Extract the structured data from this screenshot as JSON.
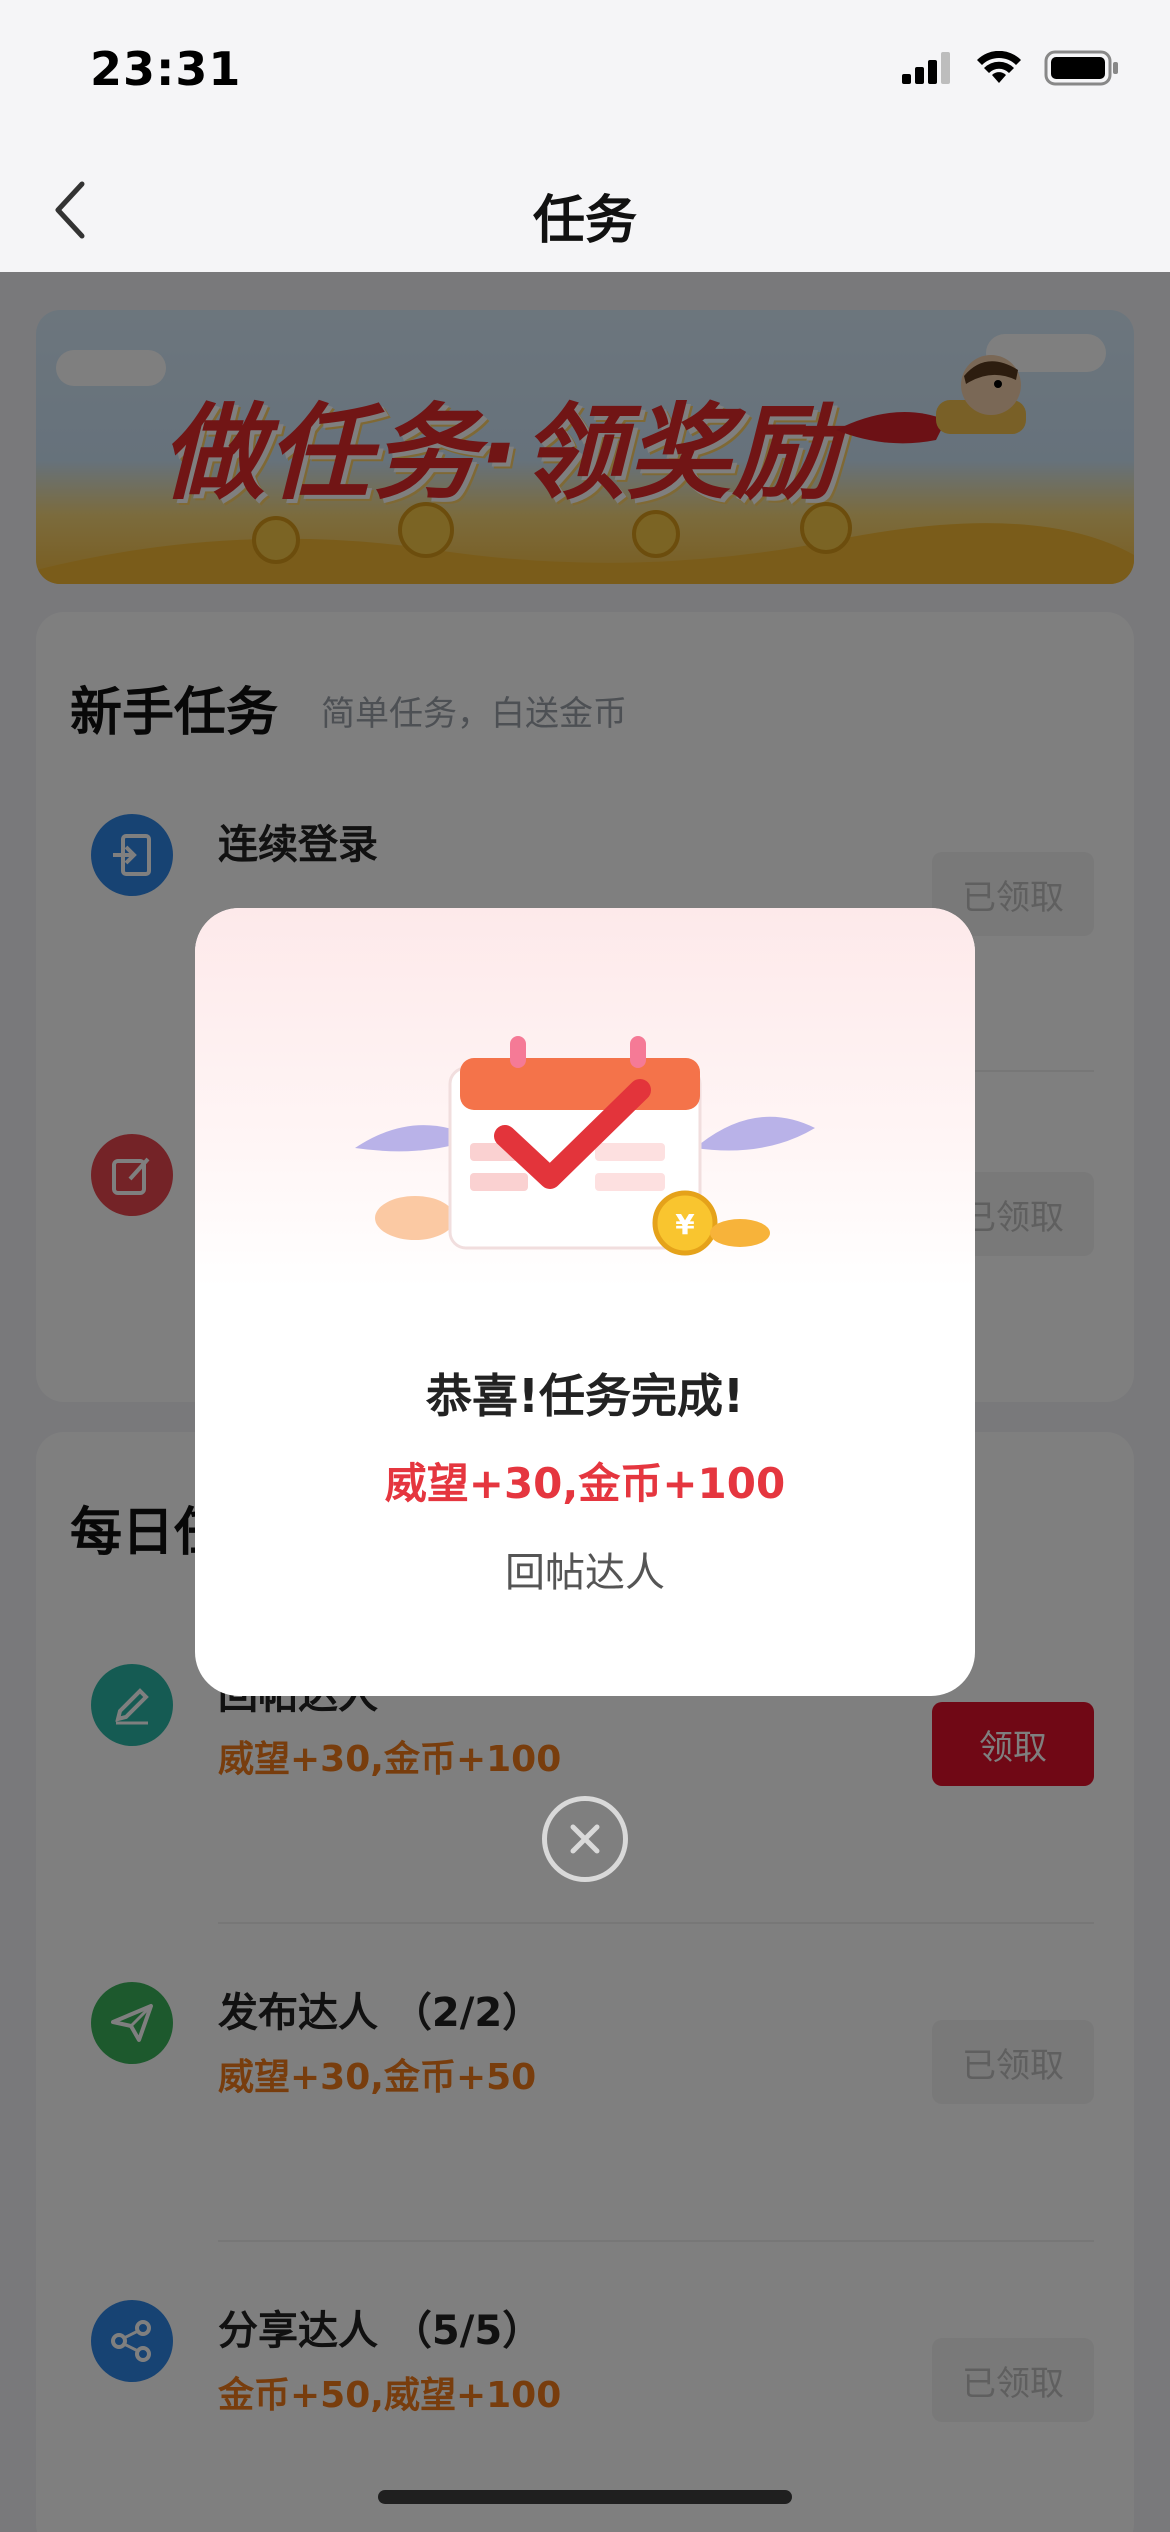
{
  "status_bar": {
    "time": "23:31"
  },
  "nav": {
    "title": "任务"
  },
  "banner": {
    "text": "做任务·领奖励"
  },
  "newbie": {
    "title": "新手任务",
    "subtitle": "简单任务，白送金币",
    "tasks": [
      {
        "name": "连续登录",
        "button": "已领取"
      },
      {
        "button": "已领取"
      }
    ]
  },
  "daily": {
    "title": "每日任务",
    "tasks": [
      {
        "name": "回帖达人",
        "reward": "威望+30,金币+100",
        "button": "领取"
      },
      {
        "name": "发布达人  （2/2）",
        "reward": "威望+30,金币+50",
        "button": "已领取"
      },
      {
        "name": "分享达人  （5/5）",
        "reward": "金币+50,威望+100",
        "button": "已领取"
      }
    ]
  },
  "modal": {
    "title": "恭喜!任务完成!",
    "reward": "威望+30,金币+100",
    "task_name": "回帖达人"
  },
  "colors": {
    "accent_red": "#e0102a",
    "reward_orange": "#f07b1a",
    "modal_red": "#e5363f"
  },
  "icons": [
    "back-chevron-icon",
    "login-icon",
    "edit-icon",
    "pencil-icon",
    "paper-plane-icon",
    "share-icon",
    "close-icon",
    "calendar-check-icon"
  ]
}
